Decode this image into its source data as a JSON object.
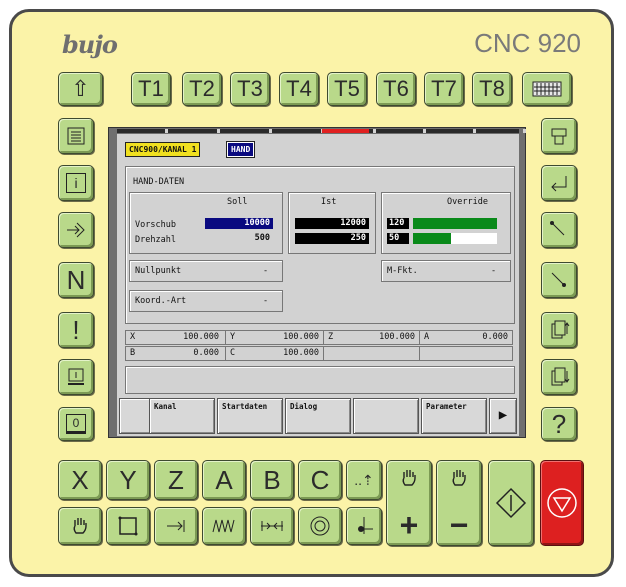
{
  "brand": {
    "logo": "bujo",
    "model": "CNC 920"
  },
  "top_keys": [
    "⇧",
    "T1",
    "T2",
    "T3",
    "T4",
    "T5",
    "T6",
    "T7",
    "T8"
  ],
  "keyboard_icon": "keyboard-icon",
  "left_keys": [
    "list-icon",
    "i",
    "arrow-in-icon",
    "N",
    "!",
    "box-underline-icon",
    "0"
  ],
  "right_keys": [
    "printer-icon",
    "enter-icon",
    "line-up-icon",
    "line-down-icon",
    "page-up-icon",
    "page-down-icon",
    "?"
  ],
  "axis_keys": [
    "X",
    "Y",
    "Z",
    "A",
    "B",
    "C",
    "..⇡"
  ],
  "bottom_keys_icons": [
    "hand-icon",
    "frame-icon",
    "arrow-bar-icon",
    "spiral-icon",
    "double-arrow-icon",
    "circle-icon",
    "rotate-icon"
  ],
  "big_keys": {
    "hand_plus": "+",
    "hand_minus": "−"
  },
  "screen": {
    "tab_channel": "CNC900/KANAL 1",
    "tab_mode": "HAND",
    "section_title": "HAND-DATEN",
    "soll_header": "Soll",
    "ist_header": "Ist",
    "override_header": "Override",
    "vorschub_label": "Vorschub",
    "drehzahl_label": "Drehzahl",
    "vorschub_soll": "10000",
    "drehzahl_soll": "500",
    "vorschub_ist": "12000",
    "drehzahl_ist": "250",
    "override_feed": "120",
    "override_spindle": "50",
    "override_feed_level": 1.0,
    "override_spindle_level": 0.45,
    "nullpunkt_label": "Nullpunkt",
    "nullpunkt_value": "-",
    "mfkt_label": "M-Fkt.",
    "mfkt_value": "-",
    "koord_label": "Koord.-Art",
    "koord_value": "-",
    "axes": [
      {
        "name": "X",
        "value": "100.000"
      },
      {
        "name": "Y",
        "value": "100.000"
      },
      {
        "name": "Z",
        "value": "100.000"
      },
      {
        "name": "A",
        "value": "0.000"
      },
      {
        "name": "B",
        "value": "0.000"
      },
      {
        "name": "C",
        "value": "100.000"
      }
    ],
    "softkeys": [
      "",
      "Kanal",
      "Startdaten",
      "Dialog",
      "",
      "Parameter"
    ],
    "softkey_next": "▶"
  }
}
